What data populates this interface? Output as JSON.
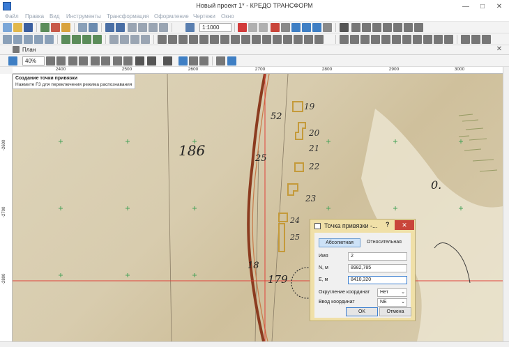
{
  "window": {
    "title": "Новый проект 1* - КРЕДО ТРАНСФОРМ",
    "minimize": "—",
    "maximize": "□",
    "close": "✕"
  },
  "menu": [
    "Файл",
    "Правка",
    "Вид",
    "Инструменты",
    "Трансформация",
    "Оформление",
    "Чертежи",
    "Окно"
  ],
  "toolbar": {
    "scale": "1:1000"
  },
  "panel": {
    "title": "План",
    "zoom": "40%"
  },
  "ruler": {
    "top": [
      "2400",
      "2500",
      "2600",
      "2700",
      "2800",
      "2900",
      "3000"
    ],
    "left": [
      "-2600",
      "-2700",
      "-2800"
    ]
  },
  "hint": {
    "title": "Создание точки привязки",
    "text": "Нажмите F3 для переключения режима распознавания"
  },
  "dialog": {
    "title": "Точка привязки -...",
    "help": "?",
    "close": "✕",
    "tab_absolute": "Абсолютная",
    "tab_relative": "Относительная",
    "name_label": "Имя",
    "name_value": "2",
    "n_label": "N, м",
    "n_value": "8982,785",
    "e_label": "E, м",
    "e_value": "8410,320",
    "rounding_label": "Округление координат",
    "rounding_value": "Нет",
    "input_label": "Ввод координат",
    "input_value": "NE",
    "ok": "OK",
    "cancel": "Отмена"
  },
  "map_labels": {
    "parcel_186": "186",
    "l25": "25",
    "l52": "52",
    "l19": "19",
    "l20": "20",
    "l21": "21",
    "l22": "22",
    "l23": "23",
    "l24": "24",
    "l25b": "25",
    "l18": "18",
    "l179": "179",
    "l0": "0."
  },
  "colors": {
    "accent": "#3c7fd0",
    "close": "#c9453a",
    "dialog_frame": "#f0e0a8",
    "crosshair": "#e0413a"
  }
}
